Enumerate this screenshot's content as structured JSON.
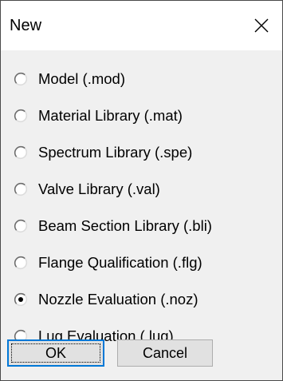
{
  "window": {
    "title": "New"
  },
  "options": [
    {
      "label": "Model  (.mod)",
      "checked": false
    },
    {
      "label": "Material Library  (.mat)",
      "checked": false
    },
    {
      "label": "Spectrum Library  (.spe)",
      "checked": false
    },
    {
      "label": "Valve Library  (.val)",
      "checked": false
    },
    {
      "label": "Beam Section Library  (.bli)",
      "checked": false
    },
    {
      "label": "Flange Qualification (.flg)",
      "checked": false
    },
    {
      "label": "Nozzle Evaluation (.noz)",
      "checked": true
    },
    {
      "label": "Lug Evaluation (.lug)",
      "checked": false
    }
  ],
  "buttons": {
    "ok_label": "OK",
    "cancel_label": "Cancel"
  },
  "icons": {
    "close": "close-icon",
    "radio": "radio-button"
  },
  "colors": {
    "dialog_background": "#f0f0f0",
    "titlebar_background": "#ffffff",
    "default_button_border": "#0078d7",
    "button_face": "#e1e1e1"
  }
}
